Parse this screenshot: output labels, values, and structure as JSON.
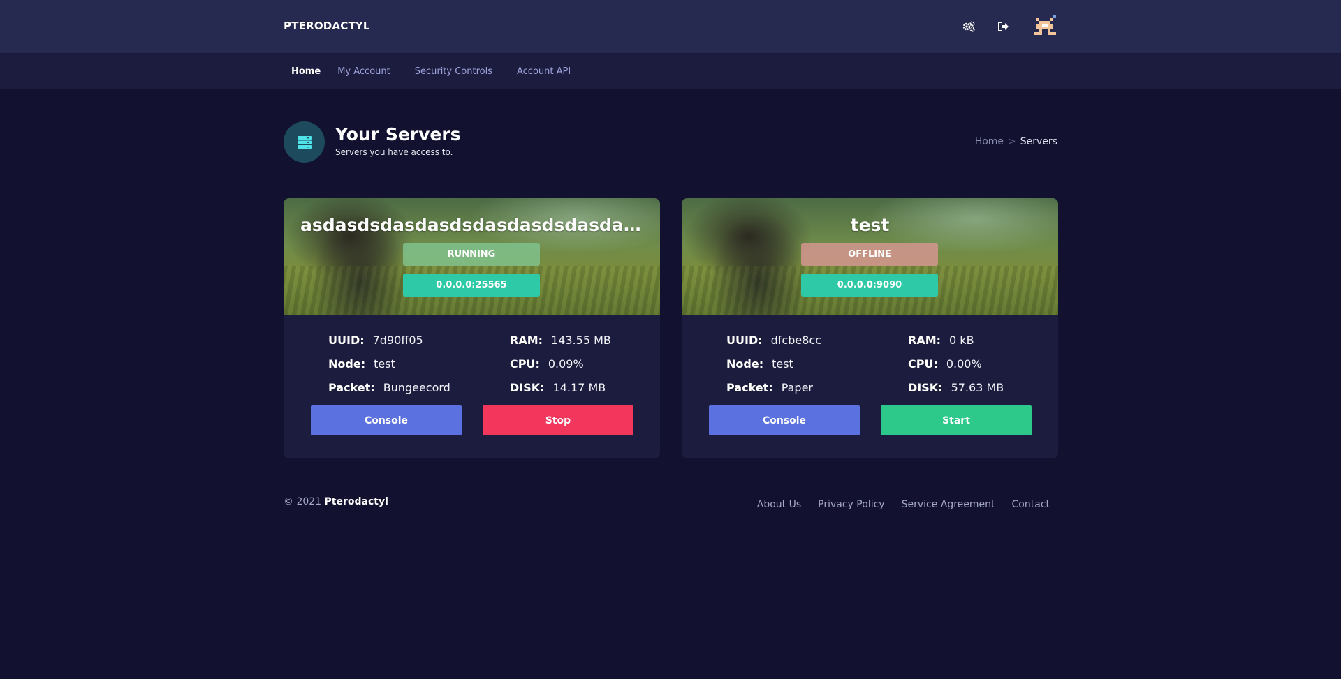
{
  "app": {
    "brand": "PTERODACTYL"
  },
  "topbar_icons": [
    "gears-icon",
    "sign-out-icon"
  ],
  "nav": [
    {
      "label": "Home",
      "active": true
    },
    {
      "label": "My Account",
      "active": false
    },
    {
      "label": "Security Controls",
      "active": false
    },
    {
      "label": "Account API",
      "active": false
    }
  ],
  "page": {
    "title": "Your Servers",
    "subtitle": "Servers you have access to.",
    "icon": "server-icon"
  },
  "breadcrumb": {
    "home": "Home",
    "separator": ">",
    "current": "Servers"
  },
  "servers": [
    {
      "name": "asdasdsdasdasdsdasdasdsdasdasdsdasd",
      "status": "RUNNING",
      "address": "0.0.0.0:25565",
      "uuid_label": "UUID:",
      "uuid": "7d90ff05",
      "node_label": "Node:",
      "node": "test",
      "packet_label": "Packet:",
      "packet": "Bungeecord",
      "ram_label": "RAM:",
      "ram": "143.55 MB",
      "cpu_label": "CPU:",
      "cpu": "0.09%",
      "disk_label": "DISK:",
      "disk": "14.17 MB",
      "console_label": "Console",
      "action_label": "Stop",
      "action_color": "#f2365c"
    },
    {
      "name": "test",
      "status": "OFFLINE",
      "address": "0.0.0.0:9090",
      "uuid_label": "UUID:",
      "uuid": "dfcbe8cc",
      "node_label": "Node:",
      "node": "test",
      "packet_label": "Packet:",
      "packet": "Paper",
      "ram_label": "RAM:",
      "ram": "0 kB",
      "cpu_label": "CPU:",
      "cpu": "0.00%",
      "disk_label": "DISK:",
      "disk": "57.63 MB",
      "console_label": "Console",
      "action_label": "Start",
      "action_color": "#2dc98a"
    }
  ],
  "footer": {
    "copyright": "© 2021",
    "company": "Pterodactyl",
    "links": [
      "About Us",
      "Privacy Policy",
      "Service Agreement",
      "Contact"
    ]
  }
}
